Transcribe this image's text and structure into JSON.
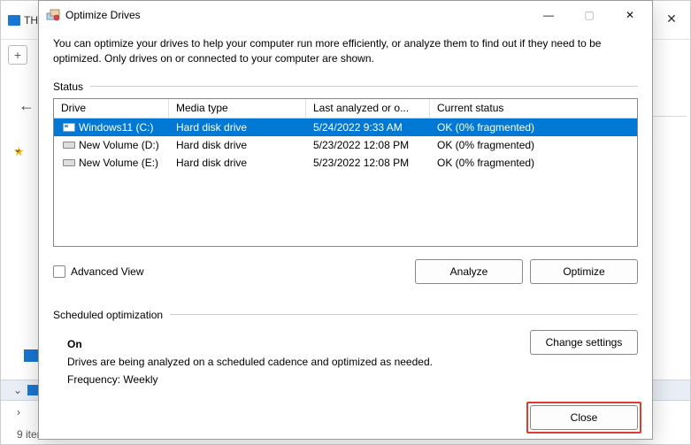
{
  "background": {
    "tab_label": "TH",
    "status_text": "9 iten",
    "win_close_glyph": "✕"
  },
  "dialog": {
    "title": "Optimize Drives",
    "description": "You can optimize your drives to help your computer run more efficiently, or analyze them to find out if they need to be optimized. Only drives on or connected to your computer are shown.",
    "status_label": "Status",
    "columns": {
      "c1": "Drive",
      "c2": "Media type",
      "c3": "Last analyzed or o...",
      "c4": "Current status"
    },
    "rows": [
      {
        "drive": "Windows11 (C:)",
        "media": "Hard disk drive",
        "last": "5/24/2022 9:33 AM",
        "status": "OK (0% fragmented)",
        "selected": true,
        "os": true
      },
      {
        "drive": "New Volume (D:)",
        "media": "Hard disk drive",
        "last": "5/23/2022 12:08 PM",
        "status": "OK (0% fragmented)",
        "selected": false,
        "os": false
      },
      {
        "drive": "New Volume (E:)",
        "media": "Hard disk drive",
        "last": "5/23/2022 12:08 PM",
        "status": "OK (0% fragmented)",
        "selected": false,
        "os": false
      }
    ],
    "advanced_label": "Advanced View",
    "analyze_label": "Analyze",
    "optimize_label": "Optimize",
    "sched_section": "Scheduled optimization",
    "sched_state": "On",
    "sched_desc": "Drives are being analyzed on a scheduled cadence and optimized as needed.",
    "sched_freq": "Frequency: Weekly",
    "change_settings_label": "Change settings",
    "close_label": "Close",
    "titlebar": {
      "min": "—",
      "max": "▢",
      "close": "✕"
    }
  }
}
